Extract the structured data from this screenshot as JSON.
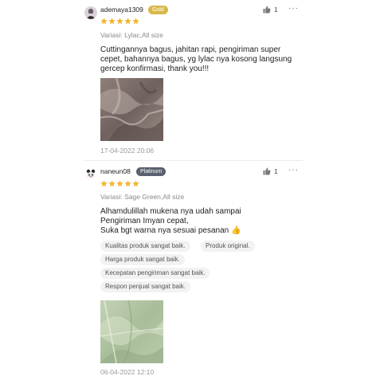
{
  "reviews": [
    {
      "username": "ademaya1309",
      "badge": "Gold",
      "likes": "1",
      "more": "···",
      "rating": 5,
      "variant": "Variasi: Lylac,All size",
      "comment": [
        "Cuttingannya bagus, jahitan rapi, pengiriman super",
        "cepet, bahannya bagus, yg lylac nya kosong langsung",
        "gercep konfirmasi, thank you!!!"
      ],
      "date": "17-04-2022 20:06"
    },
    {
      "username": "naneun08",
      "badge": "Platinum",
      "likes": "1",
      "more": "···",
      "rating": 5,
      "variant": "Variasi: Sage Green,All size",
      "comment": [
        "Alhamdulillah mukena nya udah sampai",
        "Pengiriman Imyan cepat,",
        "Suka bgt warna nya sesuai pesanan 👍"
      ],
      "tags": [
        "Kualitas produk sangat baik.",
        "Produk original.",
        "Harga produk sangat baik.",
        "Kecepatan pengiriman sangat baik.",
        "Respon penjual sangat baik."
      ],
      "date": "06-04-2022 12:10"
    }
  ],
  "colors": {
    "star": "#f2b630",
    "gold_badge": "#d8b84a",
    "platinum_badge": "#5a6070"
  },
  "icons": {
    "like": "thumbs-up-icon",
    "more": "more-horizontal-icon",
    "star": "star-icon"
  }
}
